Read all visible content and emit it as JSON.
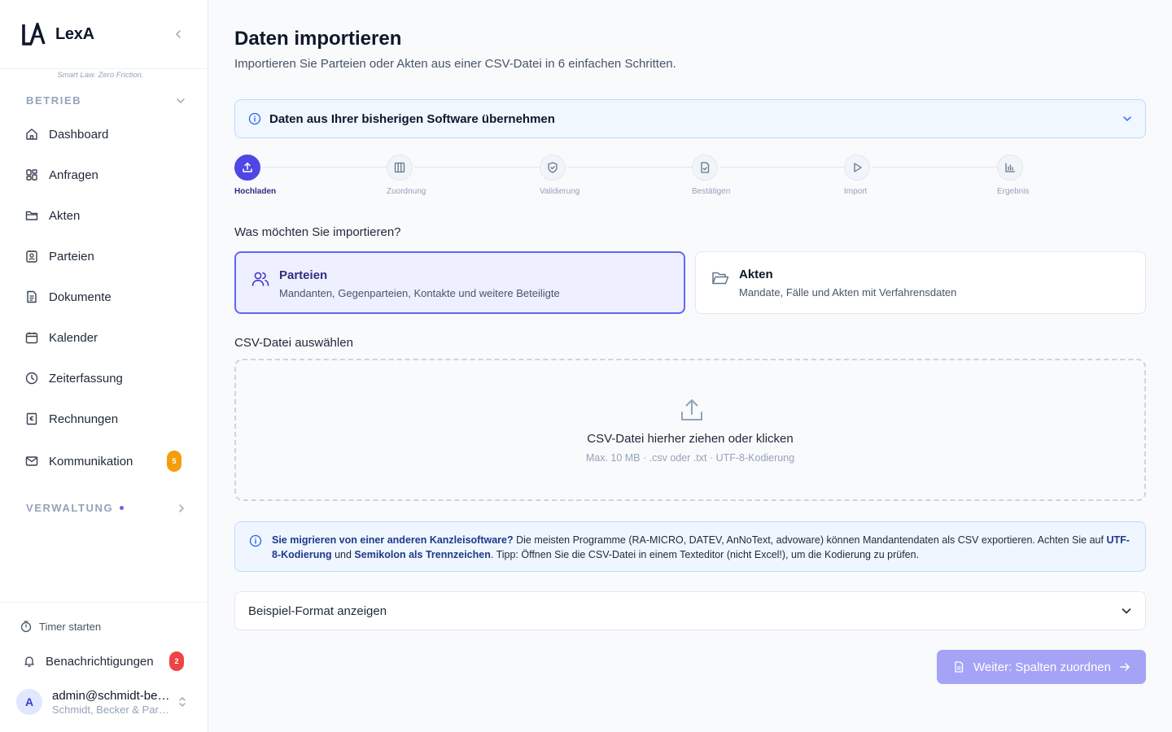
{
  "app": {
    "name": "LexA",
    "tagline": "Smart Law. Zero Friction."
  },
  "sidebar": {
    "betrieb_label": "BETRIEB",
    "verwaltung_label": "VERWALTUNG",
    "items": [
      {
        "label": "Dashboard",
        "icon": "home-icon"
      },
      {
        "label": "Anfragen",
        "icon": "grid-icon"
      },
      {
        "label": "Akten",
        "icon": "folder-icon"
      },
      {
        "label": "Parteien",
        "icon": "contact-icon"
      },
      {
        "label": "Dokumente",
        "icon": "document-icon"
      },
      {
        "label": "Kalender",
        "icon": "calendar-icon"
      },
      {
        "label": "Zeiterfassung",
        "icon": "clock-icon"
      },
      {
        "label": "Rechnungen",
        "icon": "invoice-icon"
      },
      {
        "label": "Kommunikation",
        "icon": "mail-icon",
        "badge": "5"
      }
    ],
    "timer_label": "Timer starten",
    "notifications_label": "Benachrichtigungen",
    "notifications_badge": "2",
    "user": {
      "initial": "A",
      "email": "admin@schmidt-becker.de",
      "org": "Schmidt, Becker & Partner"
    }
  },
  "main": {
    "title": "Daten importieren",
    "subtitle": "Importieren Sie Parteien oder Akten aus einer CSV-Datei in 6 einfachen Schritten.",
    "info_bar": "Daten aus Ihrer bisherigen Software übernehmen",
    "steps": [
      {
        "label": "Hochladen",
        "icon": "upload-icon",
        "active": true
      },
      {
        "label": "Zuordnung",
        "icon": "columns-icon"
      },
      {
        "label": "Validierung",
        "icon": "shield-check-icon"
      },
      {
        "label": "Bestätigen",
        "icon": "file-check-icon"
      },
      {
        "label": "Import",
        "icon": "play-icon"
      },
      {
        "label": "Ergebnis",
        "icon": "bar-chart-icon"
      }
    ],
    "question": "Was möchten Sie importieren?",
    "types": [
      {
        "title": "Parteien",
        "desc": "Mandanten, Gegenparteien, Kontakte und weitere Beteiligte",
        "icon": "users-icon",
        "selected": true
      },
      {
        "title": "Akten",
        "desc": "Mandate, Fälle und Akten mit Verfahrensdaten",
        "icon": "folder-open-icon",
        "selected": false
      }
    ],
    "csv_label": "CSV-Datei auswählen",
    "dropzone": {
      "title": "CSV-Datei hierher ziehen oder klicken",
      "hint": "Max. 10 MB · .csv oder .txt · UTF-8-Kodierung"
    },
    "tip": {
      "b1": "Sie migrieren von einer anderen Kanzleisoftware?",
      "t1": " Die meisten Programme (RA-MICRO, DATEV, AnNoText, advoware) können Mandantendaten als CSV exportieren. Achten Sie auf ",
      "b2": "UTF-8-Kodierung",
      "t2": " und ",
      "b3": "Semikolon als Trennzeichen",
      "t3": ". Tipp: Öffnen Sie die CSV-Datei in einem Texteditor (nicht Excel!), um die Kodierung zu prüfen."
    },
    "example_label": "Beispiel-Format anzeigen",
    "next_button": "Weiter: Spalten zuordnen"
  },
  "colors": {
    "accent": "#4f46e5",
    "accent_light": "#eef0ff",
    "button_disabled": "#a5a3f6",
    "badge_orange": "#f59e0b",
    "badge_red": "#ef4444",
    "info_bg": "#eff6ff",
    "info_border": "#bfdbfe"
  }
}
